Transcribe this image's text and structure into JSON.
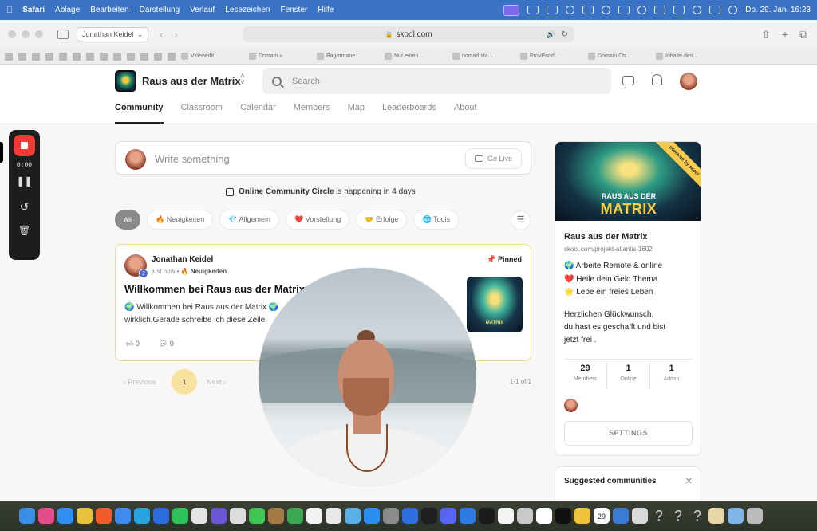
{
  "menubar": {
    "items": [
      "Safari",
      "Ablage",
      "Bearbeiten",
      "Darstellung",
      "Verlauf",
      "Lesezeichen",
      "Fenster",
      "Hilfe"
    ],
    "clock": "Do. 29. Jan.  16:23"
  },
  "browser": {
    "profile_tab": "Jonathan Keidel",
    "url": "skool.com",
    "bookmarks": [
      "Videoedit",
      "Domain »",
      "Bagermane...",
      "Nur einen...",
      "nomad.sta...",
      "ProvPand...",
      "Domain Ch...",
      "Inhalte des..."
    ]
  },
  "header": {
    "group_name": "Raus aus der Matrix",
    "search_placeholder": "Search",
    "tabs": [
      "Community",
      "Classroom",
      "Calendar",
      "Members",
      "Map",
      "Leaderboards",
      "About"
    ]
  },
  "recorder": {
    "time": "0:00"
  },
  "composer": {
    "placeholder": "Write something",
    "go_live": "Go Live"
  },
  "event": {
    "name": "Online Community Circle",
    "rest": " is happening in 4 days"
  },
  "filters": [
    {
      "label": "All"
    },
    {
      "label": "🔥 Neuigkeiten"
    },
    {
      "label": "💎 Allgemein"
    },
    {
      "label": "❤️ Vorstellung"
    },
    {
      "label": "🤝 Erfolge"
    },
    {
      "label": "🌐 Tools"
    }
  ],
  "post": {
    "author": "Jonathan Keidel",
    "level": "2",
    "time": "just now • ",
    "category": "🔥 Neuigkeiten",
    "pinned": "Pinned",
    "title": "Willkommen bei Raus aus der Matrix",
    "body_line1": "🌍 Willkommen bei Raus aus der Matrix 🌍",
    "body_line2": "wirklich.Gerade schreibe ich diese Zeile",
    "thumb_text": "MATRIX",
    "likes": "0",
    "comments": "0"
  },
  "pager": {
    "prev": "Previous",
    "page": "1",
    "next": "Next",
    "count": "1-1 of 1"
  },
  "sidebar": {
    "banner_line1": "RAUS AUS DER",
    "banner_line2": "MATRIX",
    "ribbon": "powered by skool",
    "name": "Raus aus der Matrix",
    "url": "skool.com/projekt-atlantis-1602",
    "lines": [
      "🌍 Arbeite Remote & online",
      "❤️ Heile dein Geld Thema",
      "🌟 Lebe ein freies Leben",
      "Herzlichen Glückwunsch,",
      "du hast es geschafft und bist",
      "jetzt frei ."
    ],
    "stats": [
      {
        "value": "29",
        "label": "Members"
      },
      {
        "value": "1",
        "label": "Online"
      },
      {
        "value": "1",
        "label": "Admin"
      }
    ],
    "settings": "SETTINGS",
    "suggested": "Suggested communities"
  },
  "dock": {
    "calendar_day": "29"
  }
}
